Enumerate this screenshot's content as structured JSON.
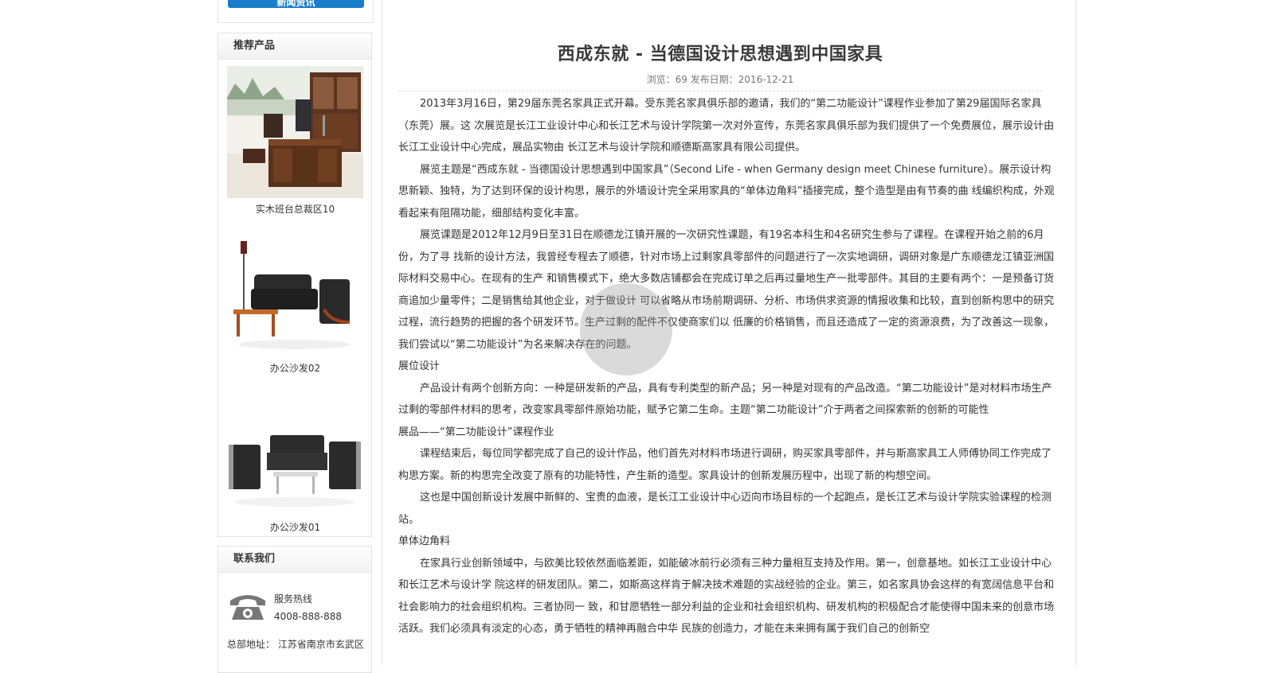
{
  "sidebar": {
    "top_button_label": "新闻资讯",
    "recommended": {
      "title": "推荐产品",
      "products": [
        {
          "name": "实木班台总裁区10"
        },
        {
          "name": "办公沙发02"
        },
        {
          "name": "办公沙发01"
        }
      ]
    },
    "contact": {
      "title": "联系我们",
      "hotline_label": "服务热线",
      "hotline_number": "4008-888-888",
      "address": "总部地址： 江苏省南京市玄武区"
    }
  },
  "article": {
    "title": "西成东就 - 当德国设计思想遇到中国家具",
    "meta": "浏览：69 发布日期：2016-12-21",
    "paragraphs": [
      {
        "indent": true,
        "text": "2013年3月16日，第29届东莞名家具正式开幕。受东莞名家具俱乐部的邀请，我们的“第二功能设计”课程作业参加了第29届国际名家具（东莞）展。这 次展览是长江工业设计中心和长江艺术与设计学院第一次对外宣传，东莞名家具俱乐部为我们提供了一个免费展位，展示设计由长江工业设计中心完成，展品实物由 长江艺术与设计学院和顺德斯高家具有限公司提供。"
      },
      {
        "indent": true,
        "text": "展览主题是“西成东就 - 当德国设计思想遇到中国家具”（Second Life - when Germany design meet Chinese furniture）。展示设计构思新颖、独特，为了达到环保的设计构思，展示的外墙设计完全采用家具的“单体边角料”插接完成，整个造型是由有节奏的曲 线编织构成，外观看起来有阻隔功能，细部结构变化丰富。"
      },
      {
        "indent": true,
        "text": "展览课题是2012年12月9日至31日在顺德龙江镇开展的一次研究性课题，有19名本科生和4名研究生参与了课程。在课程开始之前的6月份，为了寻 找新的设计方法，我曾经专程去了顺德，针对市场上过剩家具零部件的问题进行了一次实地调研，调研对象是广东顺德龙江镇亚洲国际材料交易中心。在现有的生产 和销售模式下，绝大多数店铺都会在完成订单之后再过量地生产一批零部件。其目的主要有两个：一是预备订货商追加少量零件；二是销售给其他企业，对于做设计 可以省略从市场前期调研、分析、市场供求资源的情报收集和比较，直到创新构思中的研究过程，流行趋势的把握的各个研发环节。生产过剩的配件不仅使商家们以 低廉的价格销售，而且还造成了一定的资源浪费，为了改善这一现象，我们尝试以“第二功能设计”为名来解决存在的问题。"
      },
      {
        "indent": false,
        "text": "展位设计"
      },
      {
        "indent": true,
        "text": "产品设计有两个创新方向：一种是研发新的产品，具有专利类型的新产品；另一种是对现有的产品改造。“第二功能设计”是对材料市场生产过剩的零部件材料的思考，改变家具零部件原始功能，赋予它第二生命。主题“第二功能设计”介于两者之间探索新的创新的可能性"
      },
      {
        "indent": false,
        "text": "展品——“第二功能设计”课程作业"
      },
      {
        "indent": true,
        "text": "课程结束后，每位同学都完成了自己的设计作品，他们首先对材料市场进行调研，购买家具零部件，并与斯高家具工人师傅协同工作完成了构思方案。新的构思完全改变了原有的功能特性，产生新的造型。家具设计的创新发展历程中，出现了新的构想空间。"
      },
      {
        "indent": true,
        "text": "这也是中国创新设计发展中新鲜的、宝贵的血液，是长江工业设计中心迈向市场目标的一个起跑点，是长江艺术与设计学院实验课程的检测站。"
      },
      {
        "indent": false,
        "text": "单体边角料"
      },
      {
        "indent": true,
        "text": "在家具行业创新领域中，与欧美比较依然面临差距，如能破冰前行必须有三种力量相互支持及作用。第一，创意基地。如长江工业设计中心和长江艺术与设计学 院这样的研发团队。第二，如斯高这样肯于解决技术难题的实战经验的企业。第三，如名家具协会这样的有宽阔信息平台和社会影响力的社会组织机构。三者协同一 致，和甘愿牺牲一部分利益的企业和社会组织机构、研发机构的积极配合才能使得中国未来的创意市场活跃。我们必须具有淡定的心态，勇于牺牲的精神再融合中华 民族的创造力，才能在未来拥有属于我们自己的创新空"
      }
    ]
  },
  "colors": {
    "accent": "#1a7dc9",
    "border": "#e3e3e3",
    "text": "#333333",
    "meta_text": "#777777"
  },
  "icons": {
    "contact_phone": "telephone-icon"
  }
}
